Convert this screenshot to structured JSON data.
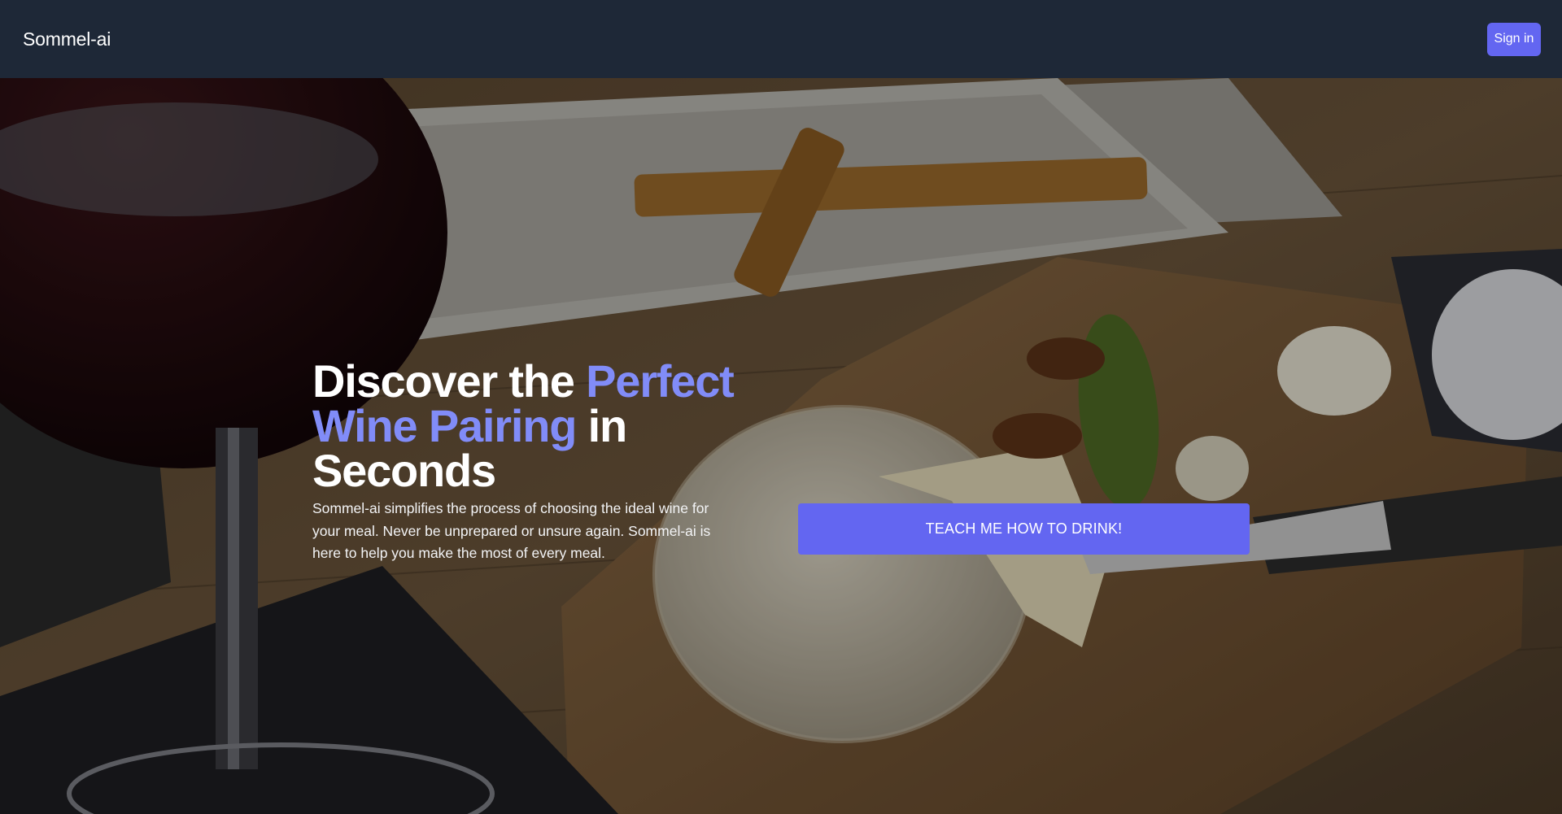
{
  "header": {
    "brand": "Sommel-ai",
    "signin_label": "Sign in"
  },
  "hero": {
    "headline_part1": "Discover the ",
    "headline_accent": "Perfect Wine Pairing",
    "headline_part2": " in Seconds",
    "description": "Sommel-ai simplifies the process of choosing the ideal wine for your meal. Never be unprepared or unsure again. Sommel-ai is here to help you make the most of every meal.",
    "cta_label": "TEACH ME HOW TO DRINK!"
  },
  "colors": {
    "header_bg": "#1e2837",
    "accent": "#818cf8",
    "button": "#6366f1"
  }
}
